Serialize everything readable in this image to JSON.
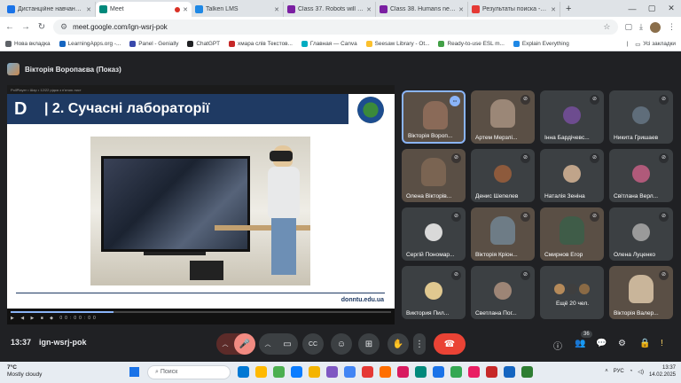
{
  "browser": {
    "tabs": [
      {
        "title": "Дистанційне навчання в ДонНТУ",
        "color": "#1a73e8",
        "active": false
      },
      {
        "title": "Meet",
        "color": "#00897b",
        "active": true
      },
      {
        "title": "Talken LMS",
        "color": "#1e88e5",
        "active": false
      },
      {
        "title": "Class 37. Robots will teach",
        "color": "#7b1fa2",
        "active": false
      },
      {
        "title": "Class 38. Humans need h",
        "color": "#7b1fa2",
        "active": false
      },
      {
        "title": "Результаты поиска - vikto",
        "color": "#e53935",
        "active": false
      }
    ],
    "new_tab": "+",
    "window_controls": {
      "minimize": "—",
      "maximize": "▢",
      "close": "✕"
    },
    "url": "meet.google.com/ign-wsrj-pok",
    "bookmarks": [
      {
        "label": "Нова вкладка",
        "color": "#5f6368"
      },
      {
        "label": "LearningApps.org -...",
        "color": "#1565c0"
      },
      {
        "label": "Panel - Genially",
        "color": "#3949ab"
      },
      {
        "label": "ChatGPT",
        "color": "#202124"
      },
      {
        "label": "хмара слів Текстов...",
        "color": "#c62828"
      },
      {
        "label": "Главная — Canva",
        "color": "#00acc1"
      },
      {
        "label": "Seesaw Library - Ot...",
        "color": "#fbc02d"
      },
      {
        "label": "Ready-to-use ESL m...",
        "color": "#43a047"
      },
      {
        "label": "Explain Everything",
        "color": "#1e88e5"
      }
    ],
    "bookmarks_folder": "Усі закладки"
  },
  "meet": {
    "presenter": "Вікторія Воропаєва (Показ)",
    "slide": {
      "toolbar_text": "PollPlayer • Шар • 12/22 рідка з п'ятою лист",
      "title": "| 2. Сучасні лабораторії",
      "logo_letter": "D",
      "site": "donntu.edu.ua",
      "progress": 0.27,
      "player_controls": "▶ ◀ ▶ ■ ◆ 00:00:00"
    },
    "participants": [
      {
        "name": "Вікторія Вороп...",
        "video": true,
        "speaking": true,
        "more": true,
        "avatar_color": "#8a6a58"
      },
      {
        "name": "Артем Мерзлі...",
        "video": true,
        "avatar_color": "#9b8777"
      },
      {
        "name": "Інна Бардічевс...",
        "video": false,
        "avatar_color": "#6d4c8f"
      },
      {
        "name": "Никита Гришаев",
        "video": false,
        "avatar_color": "#5f6d7a"
      },
      {
        "name": "Олена Вікторів...",
        "video": true,
        "avatar_color": "#7a6452"
      },
      {
        "name": "Денис Шепелев",
        "video": false,
        "avatar_color": "#8d5a3c"
      },
      {
        "name": "Наталія Зеніна",
        "video": false,
        "avatar_color": "#c0a48a"
      },
      {
        "name": "Світлана Верл...",
        "video": false,
        "avatar_color": "#b05a7a"
      },
      {
        "name": "Сергій Пономар...",
        "video": false,
        "avatar_color": "#d9d9d9"
      },
      {
        "name": "Вікторія Кріон...",
        "video": true,
        "avatar_color": "#6e7c86"
      },
      {
        "name": "Смирнов Егор",
        "video": true,
        "avatar_color": "#3f5c48"
      },
      {
        "name": "Олена Луценко",
        "video": false,
        "avatar_color": "#9a9a9a"
      },
      {
        "name": "Виктория Пил...",
        "video": false,
        "avatar_color": "#e0c890"
      },
      {
        "name": "Светлана Пог...",
        "video": false,
        "avatar_color": "#9d8576"
      },
      {
        "name": "Ещё 20 чел.",
        "video": false,
        "others": true
      },
      {
        "name": "Вікторія Валер...",
        "video": true,
        "avatar_color": "#c9b59a"
      }
    ],
    "clock": "13:37",
    "meeting_code": "ign-wsrj-pok",
    "participant_count": "36",
    "icons": {
      "mic": "🎤",
      "camera": "▭",
      "captions": "CC",
      "emoji": "☺",
      "present": "⊞",
      "hand": "✋",
      "more": "⋮",
      "hangup": "☎",
      "info": "ⓘ",
      "people": "👥",
      "chat": "💬",
      "activities": "⚙",
      "lock": "🔒"
    }
  },
  "taskbar": {
    "temperature": "7°C",
    "weather": "Mostly cloudy",
    "search_placeholder": "Поиск",
    "language": "РУС",
    "time": "13:37",
    "date": "14.02.2025",
    "apps": [
      "#0078d4",
      "#ffb900",
      "#4caf50",
      "#0a7cff",
      "#f4b400",
      "#7e57c2",
      "#4285f4",
      "#e53935",
      "#ff6f00",
      "#d81b60",
      "#00897b",
      "#1a73e8",
      "#34a853",
      "#e91e63",
      "#c62828",
      "#1565c0",
      "#2e7d32"
    ]
  }
}
